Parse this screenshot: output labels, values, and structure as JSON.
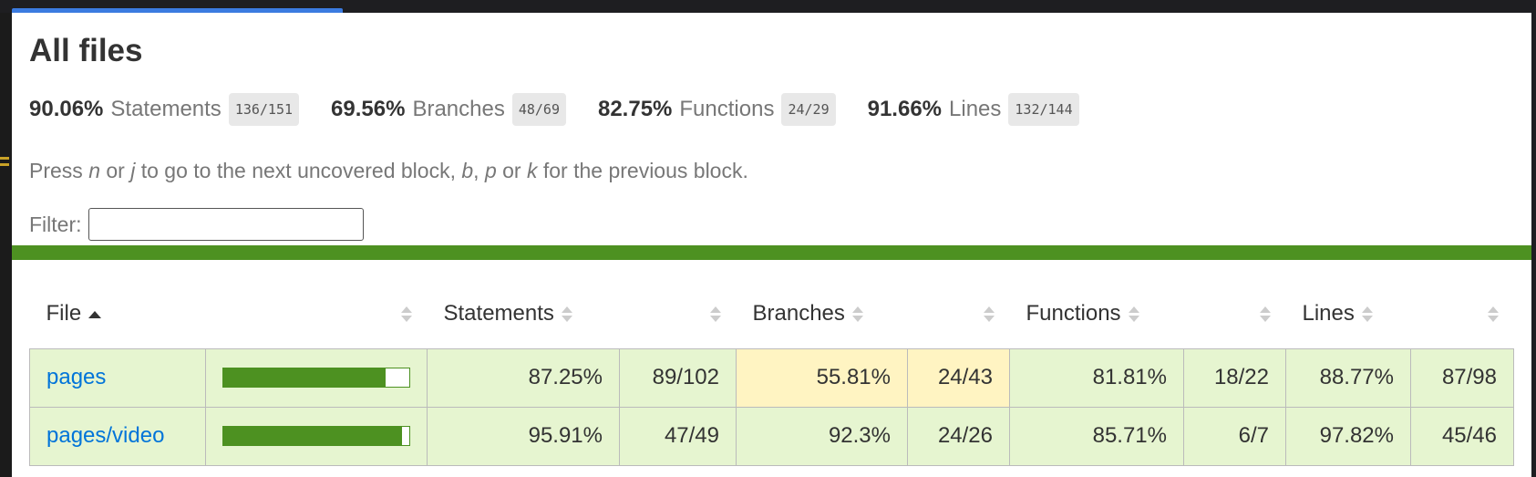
{
  "title": "All files",
  "summary": [
    {
      "pct": "90.06%",
      "label": "Statements",
      "frac": "136/151"
    },
    {
      "pct": "69.56%",
      "label": "Branches",
      "frac": "48/69"
    },
    {
      "pct": "82.75%",
      "label": "Functions",
      "frac": "24/29"
    },
    {
      "pct": "91.66%",
      "label": "Lines",
      "frac": "132/144"
    }
  ],
  "hint": {
    "t1": "Press ",
    "k1": "n",
    "t2": " or ",
    "k2": "j",
    "t3": " to go to the next uncovered block, ",
    "k3": "b",
    "t4": ", ",
    "k4": "p",
    "t5": " or ",
    "k5": "k",
    "t6": " for the previous block."
  },
  "filter": {
    "label": "Filter:",
    "value": ""
  },
  "table": {
    "headers": {
      "file": "File",
      "statements": "Statements",
      "branches": "Branches",
      "functions": "Functions",
      "lines": "Lines"
    },
    "rows": [
      {
        "file": "pages",
        "coverage": 0.8725,
        "statements_pct": "87.25%",
        "statements_frac": "89/102",
        "branches_pct": "55.81%",
        "branches_frac": "24/43",
        "functions_pct": "81.81%",
        "functions_frac": "18/22",
        "lines_pct": "88.77%",
        "lines_frac": "87/98"
      },
      {
        "file": "pages/video",
        "coverage": 0.9591,
        "statements_pct": "95.91%",
        "statements_frac": "47/49",
        "branches_pct": "92.3%",
        "branches_frac": "24/26",
        "functions_pct": "85.71%",
        "functions_frac": "6/7",
        "lines_pct": "97.82%",
        "lines_frac": "45/46"
      }
    ]
  },
  "colors": {
    "high": "#e6f5d0",
    "medium": "#fff4c2",
    "bar": "#4d9121",
    "link": "#0074d9"
  }
}
